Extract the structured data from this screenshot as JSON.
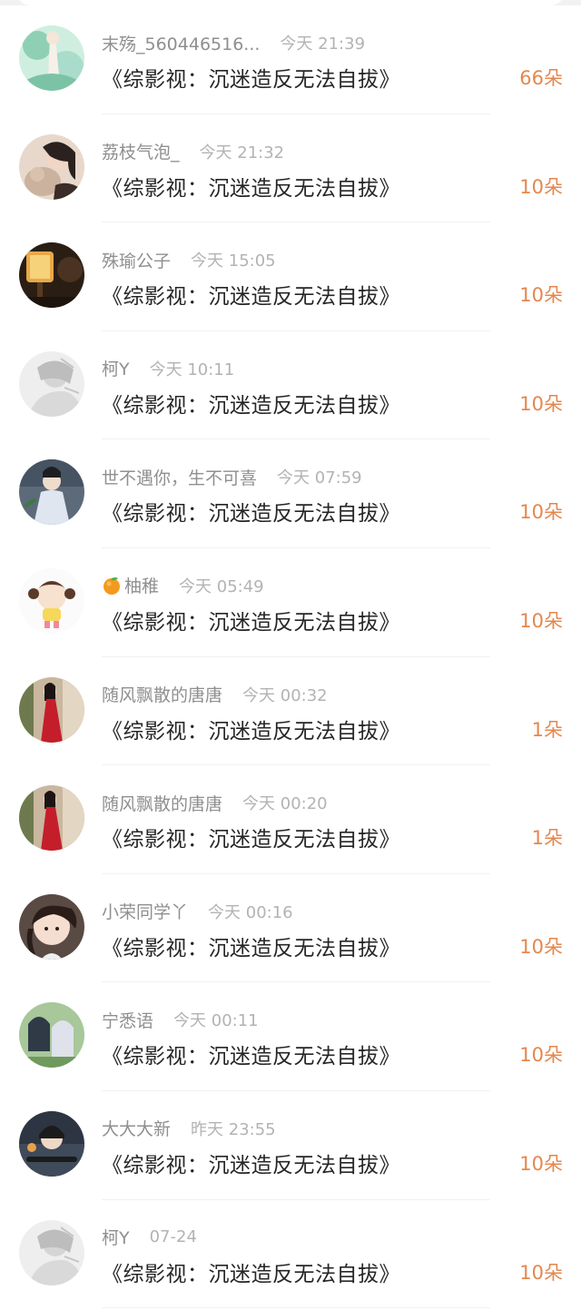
{
  "colors": {
    "accent": "#e4874d",
    "title_text": "#262626",
    "meta_text": "#9a9a9a",
    "background": "#ffffff"
  },
  "gifts": [
    {
      "name": "末殇_560446516...",
      "time": "今天 21:39",
      "book": "《综影视：沉迷造反无法自拔》",
      "count": "66朵",
      "avatar": "avatar-green-anime",
      "has_orange_icon": false
    },
    {
      "name": "荔枝气泡_",
      "time": "今天 21:32",
      "book": "《综影视：沉迷造反无法自拔》",
      "count": "10朵",
      "avatar": "avatar-girl-with-cat",
      "has_orange_icon": false
    },
    {
      "name": "殊瑜公子",
      "time": "今天 15:05",
      "book": "《综影视：沉迷造反无法自拔》",
      "count": "10朵",
      "avatar": "avatar-lantern",
      "has_orange_icon": false
    },
    {
      "name": "柯Y",
      "time": "今天 10:11",
      "book": "《综影视：沉迷造反无法自拔》",
      "count": "10朵",
      "avatar": "avatar-grey-sketch",
      "has_orange_icon": false
    },
    {
      "name": "世不遇你，生不可喜",
      "time": "今天 07:59",
      "book": "《综影视：沉迷造反无法自拔》",
      "count": "10朵",
      "avatar": "avatar-costume-man",
      "has_orange_icon": false
    },
    {
      "name": "柚稚",
      "time": "今天 05:49",
      "book": "《综影视：沉迷造反无法自拔》",
      "count": "10朵",
      "avatar": "avatar-cartoon-girl",
      "has_orange_icon": true
    },
    {
      "name": "随风飘散的唐唐",
      "time": "今天 00:32",
      "book": "《综影视：沉迷造反无法自拔》",
      "count": "1朵",
      "avatar": "avatar-red-dress",
      "has_orange_icon": false
    },
    {
      "name": "随风飘散的唐唐",
      "time": "今天 00:20",
      "book": "《综影视：沉迷造反无法自拔》",
      "count": "1朵",
      "avatar": "avatar-red-dress",
      "has_orange_icon": false
    },
    {
      "name": "小荣同学丫",
      "time": "今天 00:16",
      "book": "《综影视：沉迷造反无法自拔》",
      "count": "10朵",
      "avatar": "avatar-little-girl",
      "has_orange_icon": false
    },
    {
      "name": "宁悉语",
      "time": "今天 00:11",
      "book": "《综影视：沉迷造反无法自拔》",
      "count": "10朵",
      "avatar": "avatar-anime-duo",
      "has_orange_icon": false
    },
    {
      "name": "大大大新",
      "time": "昨天 23:55",
      "book": "《综影视：沉迷造反无法自拔》",
      "count": "10朵",
      "avatar": "avatar-car-photo",
      "has_orange_icon": false
    },
    {
      "name": "柯Y",
      "time": "07-24",
      "book": "《综影视：沉迷造反无法自拔》",
      "count": "10朵",
      "avatar": "avatar-grey-sketch",
      "has_orange_icon": false
    }
  ]
}
